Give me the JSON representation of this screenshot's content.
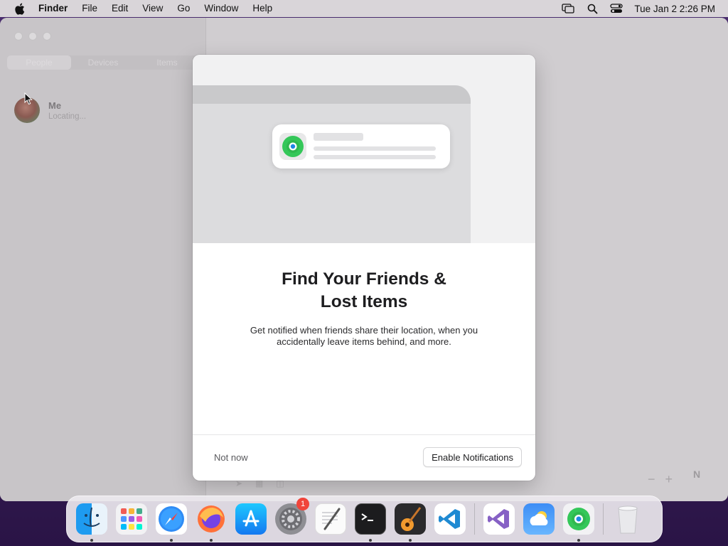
{
  "menubar": {
    "app_name": "Finder",
    "items": [
      "File",
      "Edit",
      "View",
      "Go",
      "Window",
      "Help"
    ],
    "clock": "Tue Jan 2  2:26 PM",
    "status_icons": [
      "screen-mirroring-icon",
      "search-icon",
      "control-center-icon"
    ]
  },
  "findmy": {
    "tabs": [
      "People",
      "Devices",
      "Items"
    ],
    "active_tab": "People",
    "person": {
      "name": "Me",
      "status": "Locating..."
    },
    "map_controls": {
      "zoom_out": "−",
      "zoom_in": "+",
      "compass": "N"
    }
  },
  "sheet": {
    "title_line1": "Find Your Friends &",
    "title_line2": "Lost Items",
    "body": "Get notified when friends share their location, when you accidentally leave items behind, and more.",
    "not_now_label": "Not now",
    "enable_label": "Enable Notifications"
  },
  "dock": {
    "apps": [
      "Finder",
      "Launchpad",
      "Safari",
      "Firefox",
      "App Store",
      "System Settings",
      "TextEdit",
      "Terminal",
      "GarageBand",
      "Visual Studio Code",
      "Visual Studio",
      "Weather",
      "Find My",
      "Trash"
    ],
    "system_settings_badge": "1"
  },
  "colors": {
    "accent_green": "#34c759",
    "badge_red": "#f0443a",
    "wallpaper": "#3b1f5a"
  }
}
